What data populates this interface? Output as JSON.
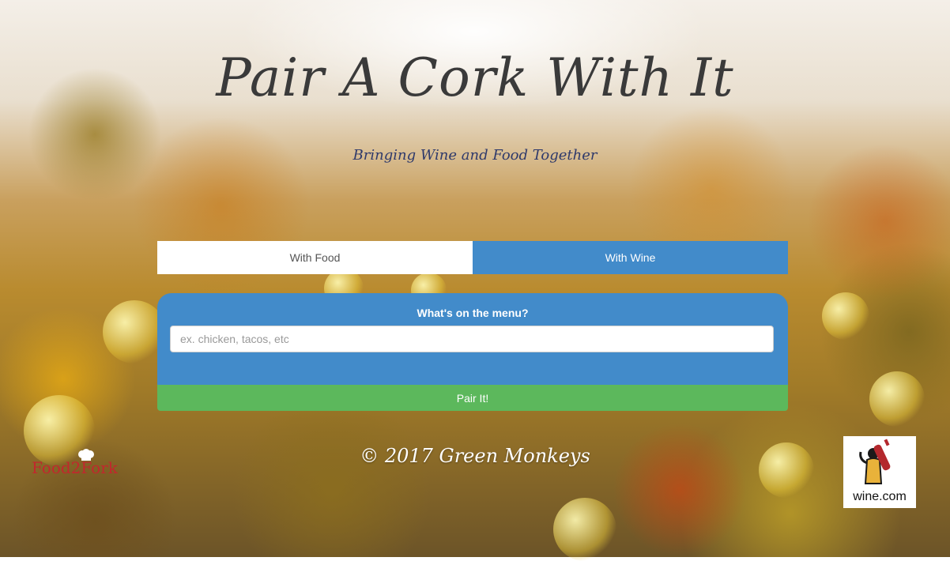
{
  "header": {
    "title": "Pair A Cork With It",
    "subtitle": "Bringing Wine and Food Together"
  },
  "tabs": [
    {
      "label": "With Food",
      "active": false
    },
    {
      "label": "With Wine",
      "active": true
    }
  ],
  "form": {
    "label": "What's on the menu?",
    "input_placeholder": "ex. chicken, tacos, etc",
    "input_value": "",
    "submit_label": "Pair It!"
  },
  "footer": {
    "copyright": "© 2017 Green Monkeys",
    "left_logo_text": "Food2Fork",
    "right_logo_text": "wine.com"
  },
  "colors": {
    "accent_blue": "#428bca",
    "button_green": "#5cb85c",
    "logo_red": "#c2272d"
  }
}
